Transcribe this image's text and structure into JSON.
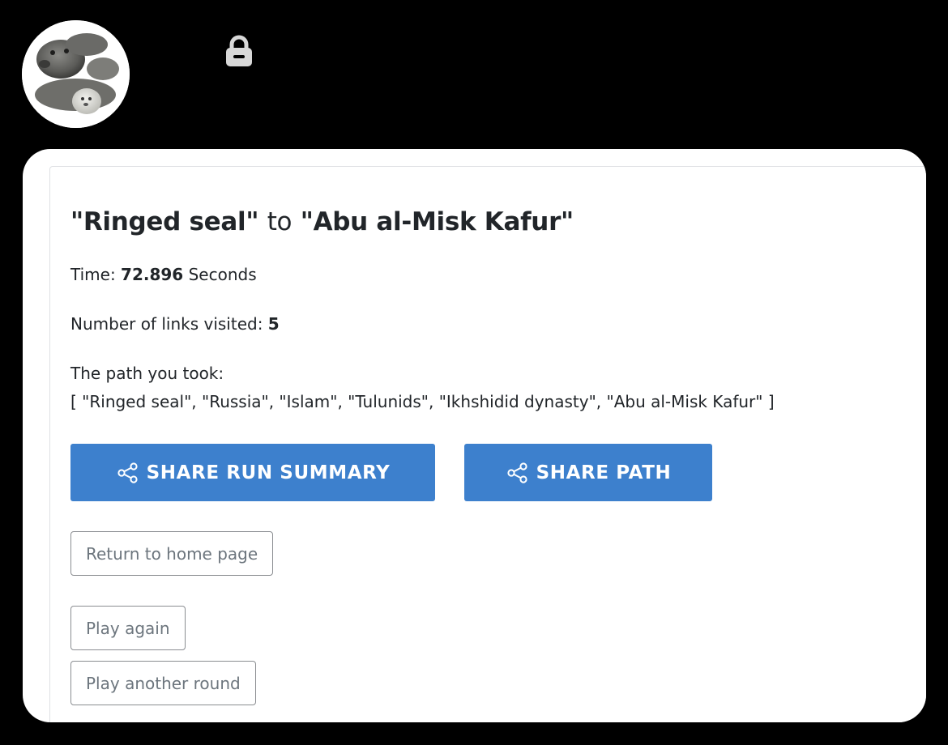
{
  "header": {
    "avatar_icon": "ringed-seal-photo",
    "lock_icon": "lock-icon"
  },
  "summary": {
    "title_from": "\"Ringed seal\"",
    "title_to_word": "to",
    "title_target": "\"Abu al-Misk Kafur\"",
    "time_label": "Time: ",
    "time_value": "72.896",
    "time_unit": " Seconds",
    "links_label": "Number of links visited: ",
    "links_value": "5",
    "path_label": "The path you took:",
    "path_value": "[ \"Ringed seal\", \"Russia\", \"Islam\", \"Tulunids\", \"Ikhshidid dynasty\", \"Abu al-Misk Kafur\" ]"
  },
  "actions": {
    "share_run_summary": "SHARE RUN SUMMARY",
    "share_path": "SHARE PATH",
    "share_icon": "share-icon",
    "return_home": "Return to home page",
    "play_again": "Play again",
    "play_another_round": "Play another round"
  },
  "colors": {
    "page_background": "#000000",
    "primary_button": "#3d80cd",
    "outline_text": "#6c757d",
    "body_text": "#212529"
  }
}
